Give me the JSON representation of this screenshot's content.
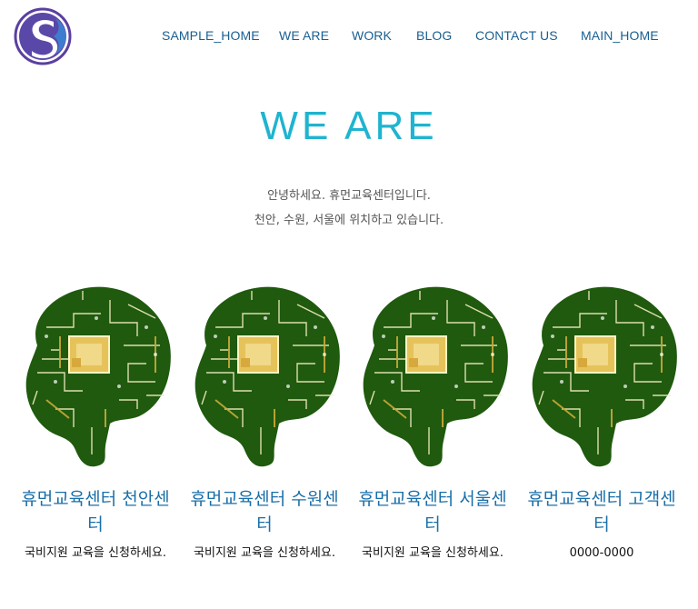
{
  "logo": {
    "icon": "s-logo-icon",
    "colors": [
      "#5b3fa0",
      "#2b7fd1"
    ]
  },
  "nav": {
    "items": [
      {
        "label": "SAMPLE_HOME"
      },
      {
        "label": "WE ARE"
      },
      {
        "label": "WORK"
      },
      {
        "label": "BLOG"
      },
      {
        "label": "CONTACT US"
      },
      {
        "label": "MAIN_HOME"
      }
    ]
  },
  "hero": {
    "title": "WE ARE",
    "intro_line1": "안녕하세요. 휴먼교육센터입니다.",
    "intro_line2": "천안, 수원, 서울에 위치하고 있습니다."
  },
  "centers": [
    {
      "title": "휴먼교육센터 천안센터",
      "desc": "국비지원 교육을 신청하세요.",
      "image": "brain-circuit-icon"
    },
    {
      "title": "휴먼교육센터 수원센터",
      "desc": "국비지원 교육을 신청하세요.",
      "image": "brain-circuit-icon"
    },
    {
      "title": "휴먼교육센터 서울센터",
      "desc": "국비지원 교육을 신청하세요.",
      "image": "brain-circuit-icon"
    },
    {
      "title": "휴먼교육센터 고객센터",
      "desc": "0000-0000",
      "image": "brain-circuit-icon"
    }
  ],
  "colors": {
    "accent": "#1fb4cf",
    "link": "#1a5f91",
    "brain_green": "#1f5a0e",
    "brain_gold": "#e6c35a"
  }
}
